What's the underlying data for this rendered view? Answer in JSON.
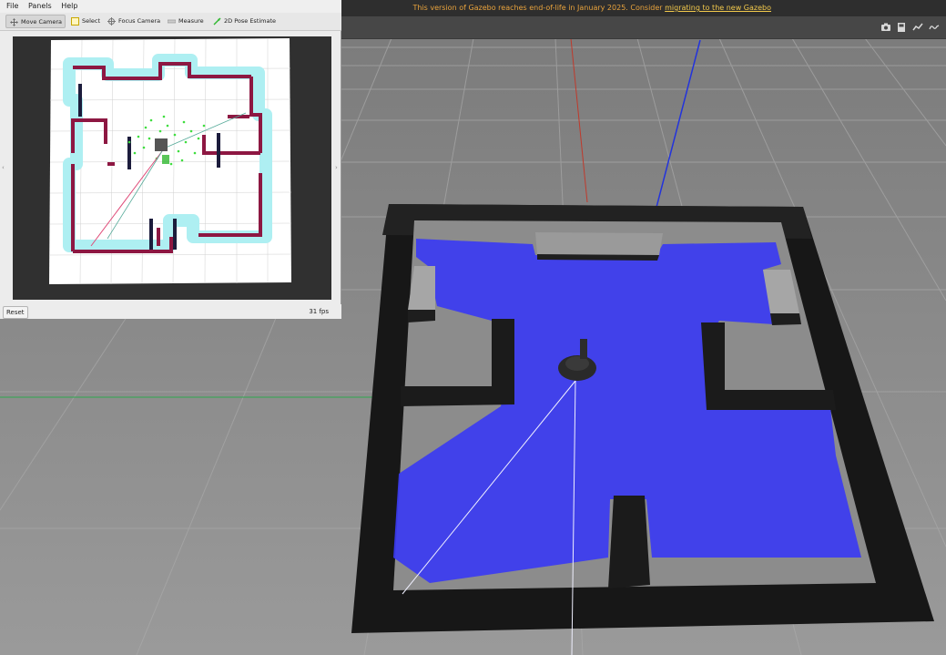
{
  "gazebo": {
    "notice_text": "This version of Gazebo reaches end-of-life in January 2025. Consider ",
    "notice_link": "migrating to the new Gazebo",
    "toolbar_icons": [
      "camera-icon",
      "save-icon",
      "plot-icon",
      "log-icon"
    ],
    "colors": {
      "ground": "#8f8f8f",
      "walls": "#1a1a1a",
      "laser": "#3737f0",
      "notice": "#e8a33d"
    }
  },
  "rviz": {
    "menu": [
      "File",
      "Panels",
      "Help"
    ],
    "tools": [
      {
        "label": "Move Camera",
        "icon": "move-camera-icon"
      },
      {
        "label": "Select",
        "icon": "select-icon"
      },
      {
        "label": "Focus Camera",
        "icon": "focus-camera-icon"
      },
      {
        "label": "Measure",
        "icon": "measure-icon"
      },
      {
        "label": "2D Pose Estimate",
        "icon": "pose-estimate-icon"
      }
    ],
    "reset_label": "Reset",
    "fps": "31 fps",
    "colors": {
      "costmap": "#aef0f2",
      "obstacle": "#9b1540",
      "particles": "#33dd33"
    }
  }
}
